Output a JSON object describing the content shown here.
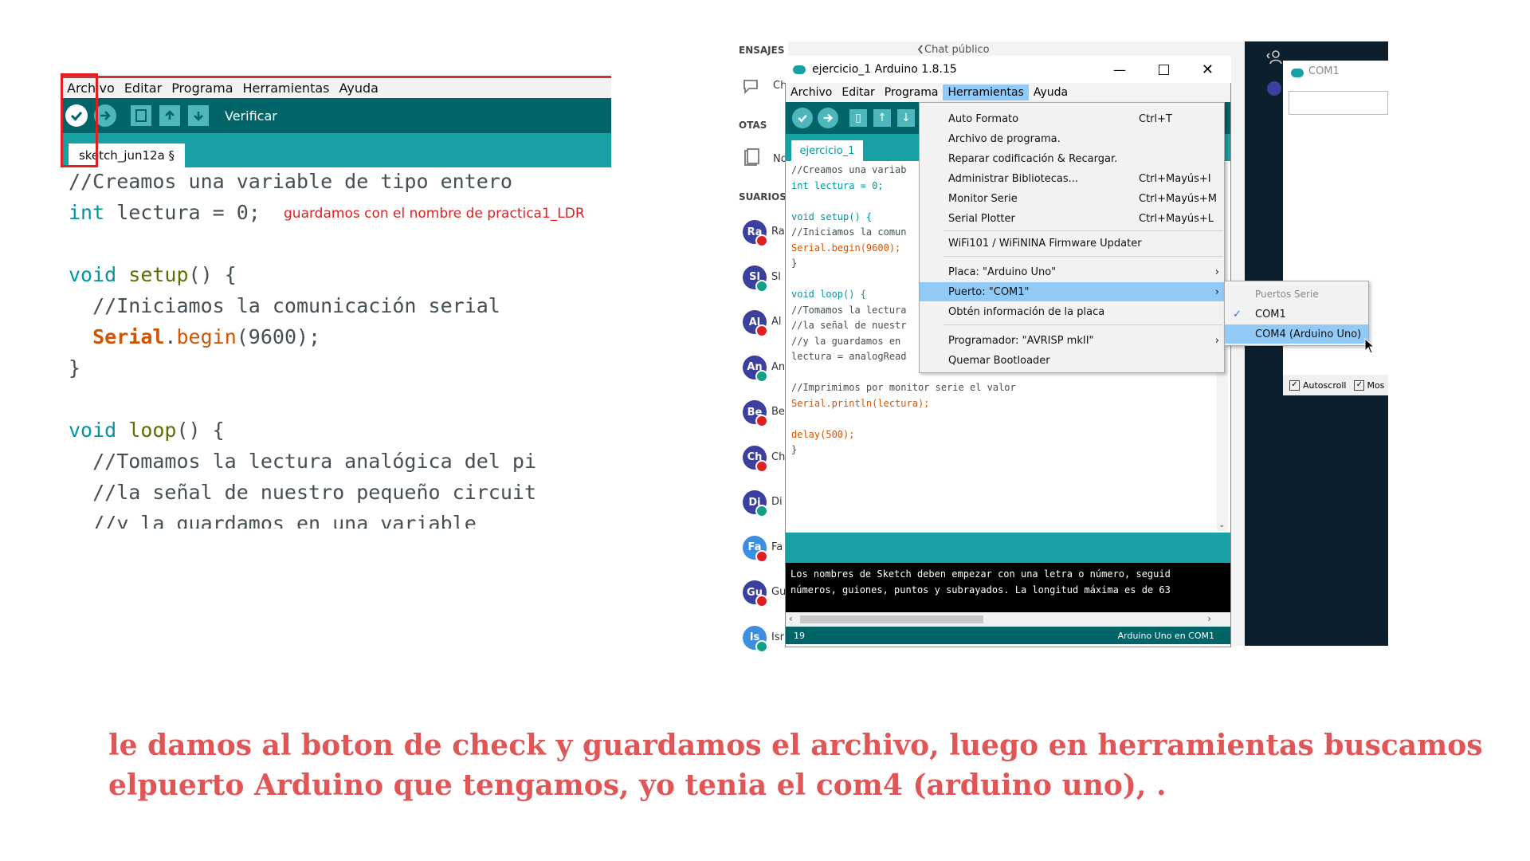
{
  "left_panel": {
    "menu": [
      "Archivo",
      "Editar",
      "Programa",
      "Herramientas",
      "Ayuda"
    ],
    "toolbar_label": "Verificar",
    "tab_name": "sketch_jun12a §",
    "annotation": "guardamos con el nombre de practica1_LDR",
    "code": {
      "l1": "//Creamos una variable de tipo entero",
      "l2_kw": "int",
      "l2_rest": " lectura = 0;",
      "l4_kw": "void",
      "l4_fn": "setup",
      "l4_rest": "() {",
      "l5": "  //Iniciamos la comunicación serial",
      "l6_cls": "Serial",
      "l6_fn": "begin",
      "l6_rest": "(9600);",
      "l7": "}",
      "l9_kw": "void",
      "l9_fn": "loop",
      "l9_rest": "() {",
      "l10": "  //Tomamos la lectura analógica del pi",
      "l11": "  //la señal de nuestro pequeño circuit",
      "l12": "  //y la guardamos en una variable"
    }
  },
  "chat": {
    "header_messages": "ENSAJES",
    "header_notes": "OTAS",
    "header_users": "SUARIOS (",
    "public_chat": "Chat público",
    "avatars": [
      {
        "initials": "Ra",
        "color": "#3b3f9e",
        "badge": "#e02020",
        "name": "Ra"
      },
      {
        "initials": "Sl",
        "color": "#3b3f9e",
        "badge": "#12a08a",
        "name": "Sl"
      },
      {
        "initials": "Al",
        "color": "#3b3f9e",
        "badge": "#e02020",
        "name": "Al"
      },
      {
        "initials": "An",
        "color": "#3b3f9e",
        "badge": "#12a08a",
        "name": "An"
      },
      {
        "initials": "Be",
        "color": "#3b3f9e",
        "badge": "#e02020",
        "name": "Be"
      },
      {
        "initials": "Ch",
        "color": "#3b3f9e",
        "badge": "#e02020",
        "name": "Ch"
      },
      {
        "initials": "Di",
        "color": "#3b3f9e",
        "badge": "#12a08a",
        "name": "Di"
      },
      {
        "initials": "Fa",
        "color": "#3b8ee0",
        "badge": "#e02020",
        "name": "Fa"
      },
      {
        "initials": "Gu",
        "color": "#3b3f9e",
        "badge": "#e02020",
        "name": "Gu"
      },
      {
        "initials": "Is",
        "color": "#3b8ee0",
        "badge": "#12a08a",
        "name": "Isr"
      }
    ],
    "side_labels": [
      "Ch",
      "No"
    ]
  },
  "ide": {
    "title": "ejercicio_1 Arduino 1.8.15",
    "menu": [
      "Archivo",
      "Editar",
      "Programa",
      "Herramientas",
      "Ayuda"
    ],
    "active_menu": "Herramientas",
    "tab_name": "ejercicio_1",
    "code": [
      {
        "t": "//Creamos una variab",
        "c": "cm"
      },
      {
        "t": "int lectura = 0;",
        "c": "kw1"
      },
      {
        "t": "",
        "c": ""
      },
      {
        "t": "void setup() {",
        "c": "kw1"
      },
      {
        "t": "//Iniciamos la comun",
        "c": "cm"
      },
      {
        "t": "Serial.begin(9600);",
        "c": "cls1"
      },
      {
        "t": "}",
        "c": ""
      },
      {
        "t": "",
        "c": ""
      },
      {
        "t": "void loop() {",
        "c": "kw1"
      },
      {
        "t": "//Tomamos la lectura",
        "c": "cm"
      },
      {
        "t": "//la señal de nuestr",
        "c": "cm"
      },
      {
        "t": "//y la guardamos en",
        "c": "cm"
      },
      {
        "t": "lectura = analogRead",
        "c": "cls2"
      },
      {
        "t": "",
        "c": ""
      },
      {
        "t": "//Imprimimos por monitor serie el valor",
        "c": "cm"
      },
      {
        "t": "Serial.println(lectura);",
        "c": "cls1"
      },
      {
        "t": "",
        "c": ""
      },
      {
        "t": "delay(500);",
        "c": "cls3"
      },
      {
        "t": "}",
        "c": ""
      }
    ],
    "console": [
      "Los nombres de Sketch deben empezar con una letra o número, seguid",
      "números, guiones, puntos y subrayados. La longitud máxima es de 63"
    ],
    "status_line": "19",
    "status_board": "Arduino Uno en COM1"
  },
  "tools_menu": {
    "items": [
      {
        "label": "Auto Formato",
        "shortcut": "Ctrl+T"
      },
      {
        "label": "Archivo de programa.",
        "shortcut": ""
      },
      {
        "label": "Reparar codificación & Recargar.",
        "shortcut": ""
      },
      {
        "label": "Administrar Bibliotecas...",
        "shortcut": "Ctrl+Mayús+I"
      },
      {
        "label": "Monitor Serie",
        "shortcut": "Ctrl+Mayús+M"
      },
      {
        "label": "Serial Plotter",
        "shortcut": "Ctrl+Mayús+L"
      },
      {
        "label": "WiFi101 / WiFiNINA Firmware Updater",
        "shortcut": ""
      },
      {
        "label": "Placa: \"Arduino Uno\"",
        "shortcut": ""
      },
      {
        "label": "Puerto: \"COM1\"",
        "shortcut": ""
      },
      {
        "label": "Obtén información de la placa",
        "shortcut": ""
      },
      {
        "label": "Programador: \"AVRISP mkII\"",
        "shortcut": ""
      },
      {
        "label": "Quemar Bootloader",
        "shortcut": ""
      }
    ]
  },
  "ports_submenu": {
    "header": "Puertos Serie",
    "items": [
      "COM1",
      "COM4 (Arduino Uno)"
    ]
  },
  "serial_monitor": {
    "title": "COM1",
    "autoscroll": "Autoscroll",
    "show": "Mos"
  },
  "caption": {
    "line1": "le damos al boton de check y guardamos el archivo, luego en herramientas buscamos",
    "line2": "elpuerto Arduino que tengamos, yo tenia el com4 (arduino uno), ."
  }
}
